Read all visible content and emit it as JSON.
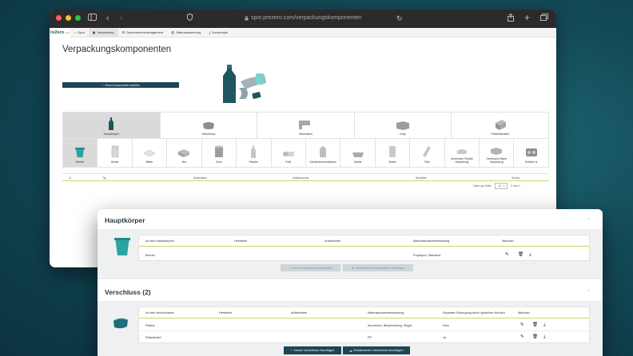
{
  "browser": {
    "url": "spot.prezero.com/verpackungskomponenten",
    "colors": {
      "close": "#ff5f57",
      "minimize": "#febc2e",
      "maximize": "#28c840"
    }
  },
  "topnav": {
    "logo": "reZero",
    "logo_sub": "spot",
    "items": [
      {
        "label": "Spot",
        "icon": "home-icon"
      },
      {
        "label": "Verpackung",
        "icon": "box-icon"
      },
      {
        "label": "Dokumentenmanagement",
        "icon": "gear-icon"
      },
      {
        "label": "Datenauswertung",
        "icon": "chart-icon"
      },
      {
        "label": "Downloads",
        "icon": "download-icon"
      }
    ]
  },
  "page": {
    "title": "Verpackungskomponenten",
    "new_component_button": "Neue Komponente erstellen"
  },
  "categories": [
    {
      "label": "Hauptkörper",
      "icon": "bottle-icon"
    },
    {
      "label": "Verschluss",
      "icon": "cap-icon"
    },
    {
      "label": "Dekoration",
      "icon": "label-icon"
    },
    {
      "label": "Inlay",
      "icon": "inlay-icon"
    },
    {
      "label": "Packhilfsmittel",
      "icon": "packaging-aid-icon"
    }
  ],
  "subcategories": [
    {
      "label": "Becher",
      "icon": "cup-icon"
    },
    {
      "label": "Beutel",
      "icon": "bag-icon"
    },
    {
      "label": "Blister",
      "icon": "blister-icon"
    },
    {
      "label": "Box",
      "icon": "box-icon"
    },
    {
      "label": "Dose",
      "icon": "can-icon"
    },
    {
      "label": "Flasche",
      "icon": "bottle-icon"
    },
    {
      "label": "Folie",
      "icon": "foil-icon"
    },
    {
      "label": "Getränkeverbundkarton",
      "icon": "carton-icon"
    },
    {
      "label": "Schale",
      "icon": "tray-icon"
    },
    {
      "label": "Tasche",
      "icon": "pouch-icon"
    },
    {
      "label": "Tube",
      "icon": "tube-icon"
    },
    {
      "label": "Generische Flexible Verpackung",
      "icon": "flexible-icon"
    },
    {
      "label": "Generische Starre Verpackung",
      "icon": "rigid-icon"
    },
    {
      "label": "Gebinde ⚙",
      "icon": "bundle-icon"
    }
  ],
  "list": {
    "headers": [
      "Id",
      "Typ",
      "Artikelname",
      "Artikelnummer",
      "Hersteller",
      "Grösse"
    ],
    "pager": {
      "label": "Zeilen pro Seite:",
      "value": "10",
      "range": "0 von 0"
    }
  },
  "hauptkoerper": {
    "title": "Hauptkörper",
    "headers": [
      "Art des Hauptkörpers",
      "Hersteller",
      "Artikelname",
      "Materialzusammensetzung",
      "Aktionen"
    ],
    "rows": [
      {
        "art": "Becher",
        "hersteller": "",
        "artikel": "",
        "material": "Polystyrol, Standard"
      }
    ],
    "btn_new": "Neuen Hauptkörper hinzufügen",
    "btn_existing": "Existierenden Hauptkörper hinzufügen"
  },
  "verschluss": {
    "title": "Verschluss (2)",
    "headers": [
      "Art des Verschlusses",
      "Hersteller",
      "Artikelname",
      "Materialzusammensetzung",
      "Separate Entsorgung durch typischen Kunden",
      "Aktionen"
    ],
    "rows": [
      {
        "art": "Platine",
        "hersteller": "",
        "artikel": "",
        "material": "Aluminium, Beschichtung, Siegel",
        "separate": "Nein"
      },
      {
        "art": "Stülpdeckel",
        "hersteller": "",
        "artikel": "",
        "material": "PP",
        "separate": "Ja"
      }
    ],
    "btn_new": "Neuen Verschluss hinzufügen",
    "btn_existing": "Existierenden Verschluss hinzufügen"
  }
}
